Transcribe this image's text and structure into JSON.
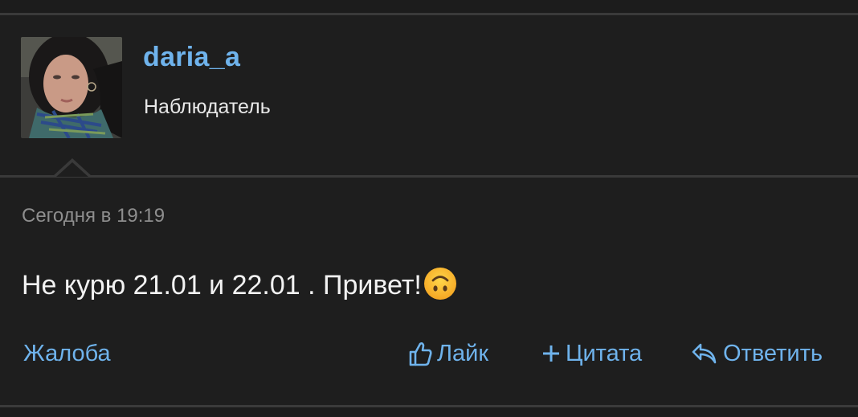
{
  "post": {
    "author": {
      "username": "daria_a",
      "role": "Наблюдатель"
    },
    "timestamp": "Сегодня в 19:19",
    "message": "Не курю 21.01 и 22.01 . Привет!",
    "emoji_icon": "upside-down-face-icon"
  },
  "actions": {
    "report_label": "Жалоба",
    "like_label": "Лайк",
    "quote_label": "Цитата",
    "reply_label": "Ответить"
  },
  "colors": {
    "background": "#1e1e1e",
    "accent": "#6fb3ec",
    "text": "#f2f2f2",
    "muted": "#8e8e8e",
    "divider": "#3a3a3a"
  }
}
